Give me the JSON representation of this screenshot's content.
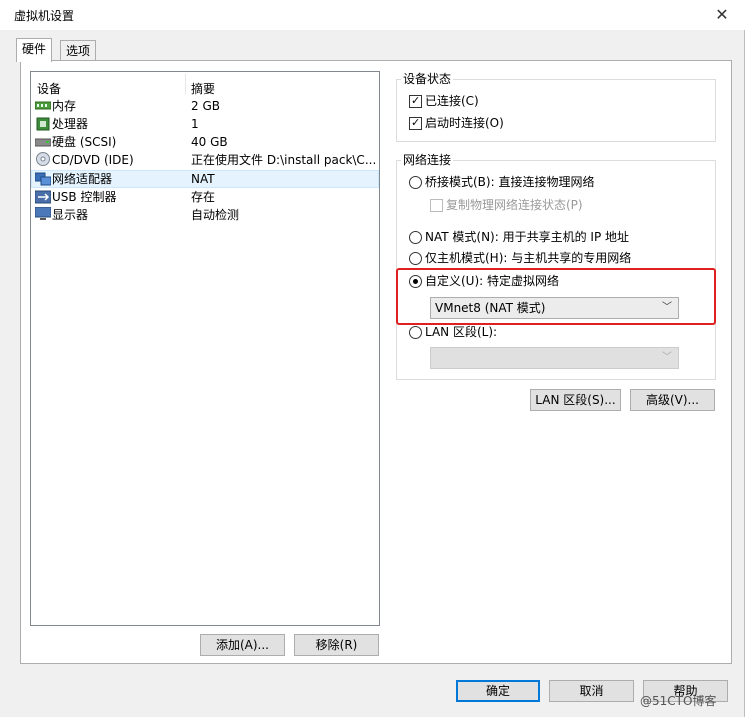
{
  "window": {
    "title": "虚拟机设置",
    "close_icon": "close-icon"
  },
  "tabs": [
    {
      "label": "硬件"
    },
    {
      "label": "选项"
    }
  ],
  "device_list": {
    "header_device": "设备",
    "header_summary": "摘要",
    "rows": [
      {
        "name": "内存",
        "summary": "2 GB",
        "icon": "memory-icon"
      },
      {
        "name": "处理器",
        "summary": "1",
        "icon": "cpu-icon"
      },
      {
        "name": "硬盘 (SCSI)",
        "summary": "40 GB",
        "icon": "harddisk-icon"
      },
      {
        "name": "CD/DVD (IDE)",
        "summary": "正在使用文件 D:\\install pack\\C...",
        "icon": "cd-icon"
      },
      {
        "name": "网络适配器",
        "summary": "NAT",
        "icon": "network-icon",
        "selected": true
      },
      {
        "name": "USB 控制器",
        "summary": "存在",
        "icon": "usb-icon"
      },
      {
        "name": "显示器",
        "summary": "自动检测",
        "icon": "monitor-icon"
      }
    ]
  },
  "list_buttons": {
    "add": "添加(A)...",
    "remove": "移除(R)"
  },
  "device_status": {
    "title": "设备状态",
    "connected": {
      "label": "已连接(C)",
      "checked": true
    },
    "connect_at_power_on": {
      "label": "启动时连接(O)",
      "checked": true
    }
  },
  "network_connection": {
    "title": "网络连接",
    "bridged": {
      "label": "桥接模式(B): 直接连接物理网络",
      "checked": false
    },
    "replicate": {
      "label": "复制物理网络连接状态(P)",
      "checked": false,
      "disabled": true
    },
    "nat": {
      "label": "NAT 模式(N): 用于共享主机的 IP 地址",
      "checked": false
    },
    "host_only": {
      "label": "仅主机模式(H): 与主机共享的专用网络",
      "checked": false
    },
    "custom": {
      "label": "自定义(U): 特定虚拟网络",
      "checked": true
    },
    "custom_select": {
      "value": "VMnet8 (NAT 模式)"
    },
    "lan_segment": {
      "label": "LAN 区段(L):",
      "checked": false
    },
    "lan_select": {
      "value": "",
      "disabled": true
    }
  },
  "right_buttons": {
    "lan_segments": "LAN 区段(S)...",
    "advanced": "高级(V)..."
  },
  "footer_buttons": {
    "ok": "确定",
    "cancel": "取消",
    "help": "帮助"
  },
  "watermark": "@51CTO博客",
  "colors": {
    "highlight_box": "#e02020",
    "selection": "#e5f3ff",
    "primary_border": "#0078d7"
  }
}
